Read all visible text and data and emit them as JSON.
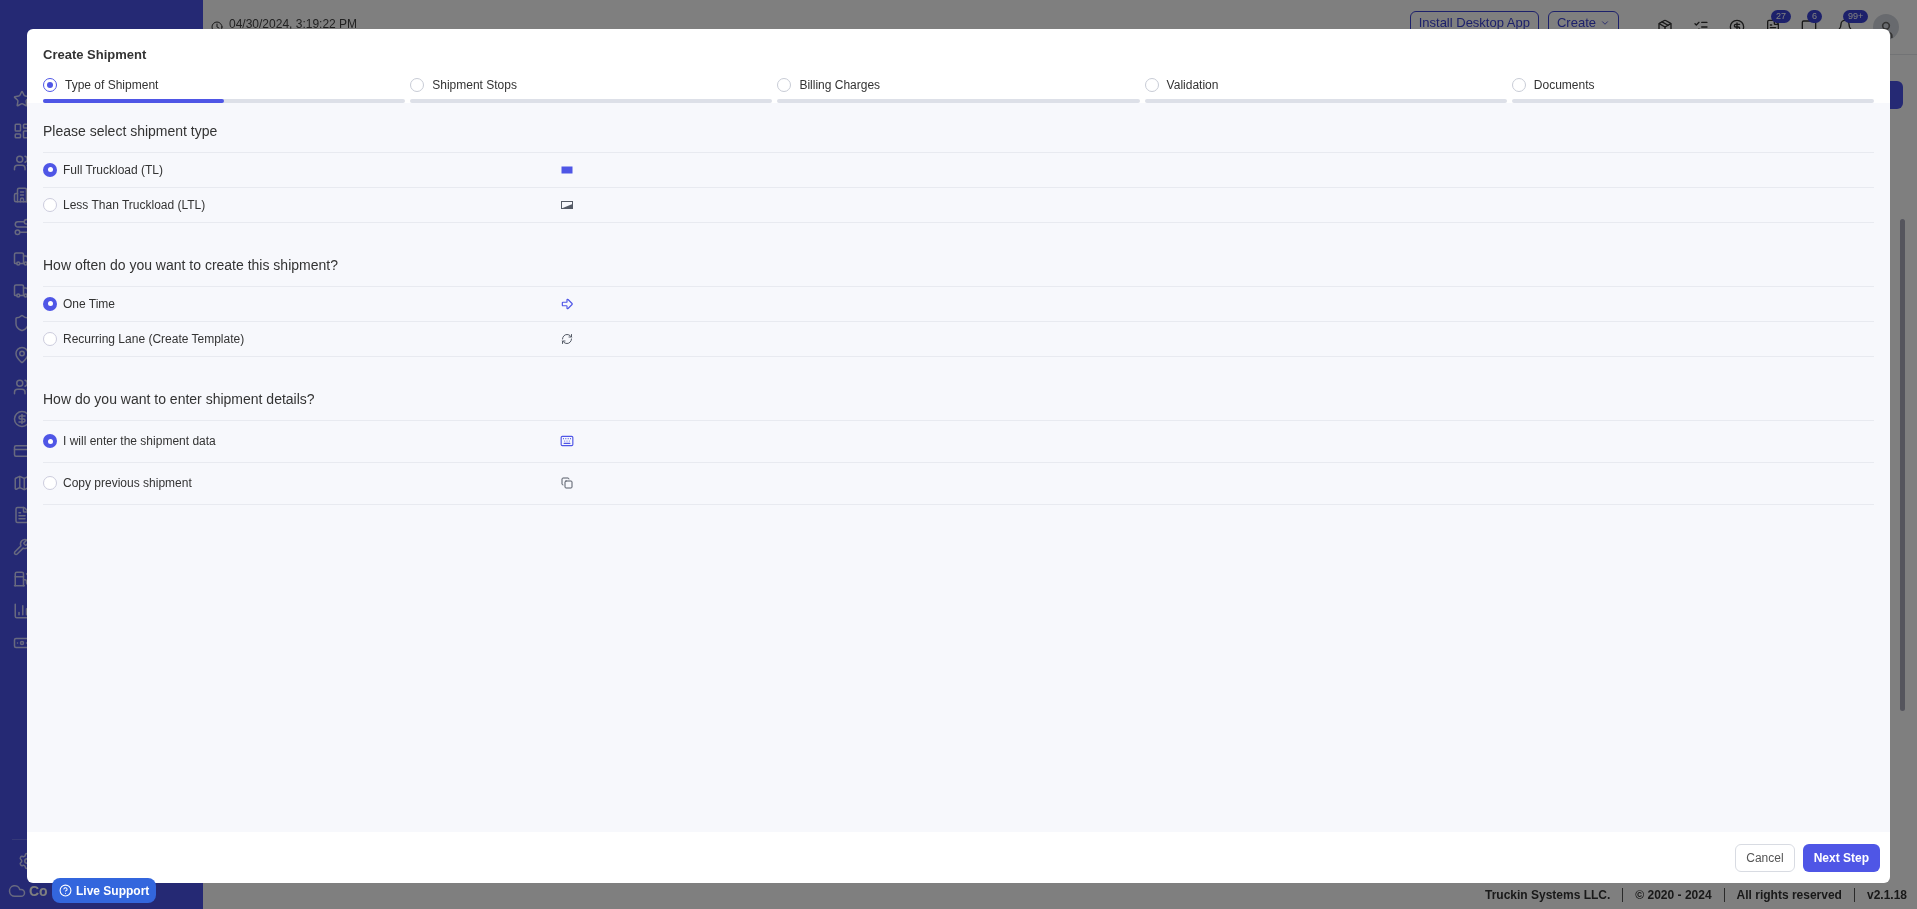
{
  "header": {
    "datetime": "04/30/2024, 3:19:22 PM",
    "buttons": [
      "Install Desktop App",
      "Create"
    ],
    "badges": [
      "27",
      "6",
      "99+"
    ]
  },
  "sidebar": {
    "footer_item": "Co"
  },
  "modal": {
    "title": "Create Shipment",
    "steps": [
      {
        "label": "Type of Shipment",
        "selected": true,
        "level": 0.5
      },
      {
        "label": "Shipment Stops",
        "selected": false
      },
      {
        "label": "Billing Charges",
        "selected": false
      },
      {
        "label": "Validation",
        "selected": false
      },
      {
        "label": "Documents",
        "selected": false
      }
    ],
    "sections": [
      {
        "heading": "Please select shipment type",
        "options": [
          {
            "label": "Full Truckload (TL)",
            "selected": true
          },
          {
            "label": "Less Than Truckload (LTL)",
            "selected": false
          }
        ]
      },
      {
        "heading": "How often do you want to create this shipment?",
        "options": [
          {
            "label": "One Time",
            "selected": true
          },
          {
            "label": "Recurring Lane (Create Template)",
            "selected": false
          }
        ]
      },
      {
        "heading": "How do you want to enter shipment details?",
        "options": [
          {
            "label": "I will enter the shipment data",
            "selected": true
          },
          {
            "label": "Copy previous shipment",
            "selected": false
          }
        ]
      }
    ],
    "buttons": {
      "cancel": "Cancel",
      "next": "Next Step"
    }
  },
  "live_support": "Live Support",
  "footer": [
    "Truckin Systems LLC.",
    "© 2020 - 2024",
    "All rights reserved",
    "v2.1.18"
  ]
}
